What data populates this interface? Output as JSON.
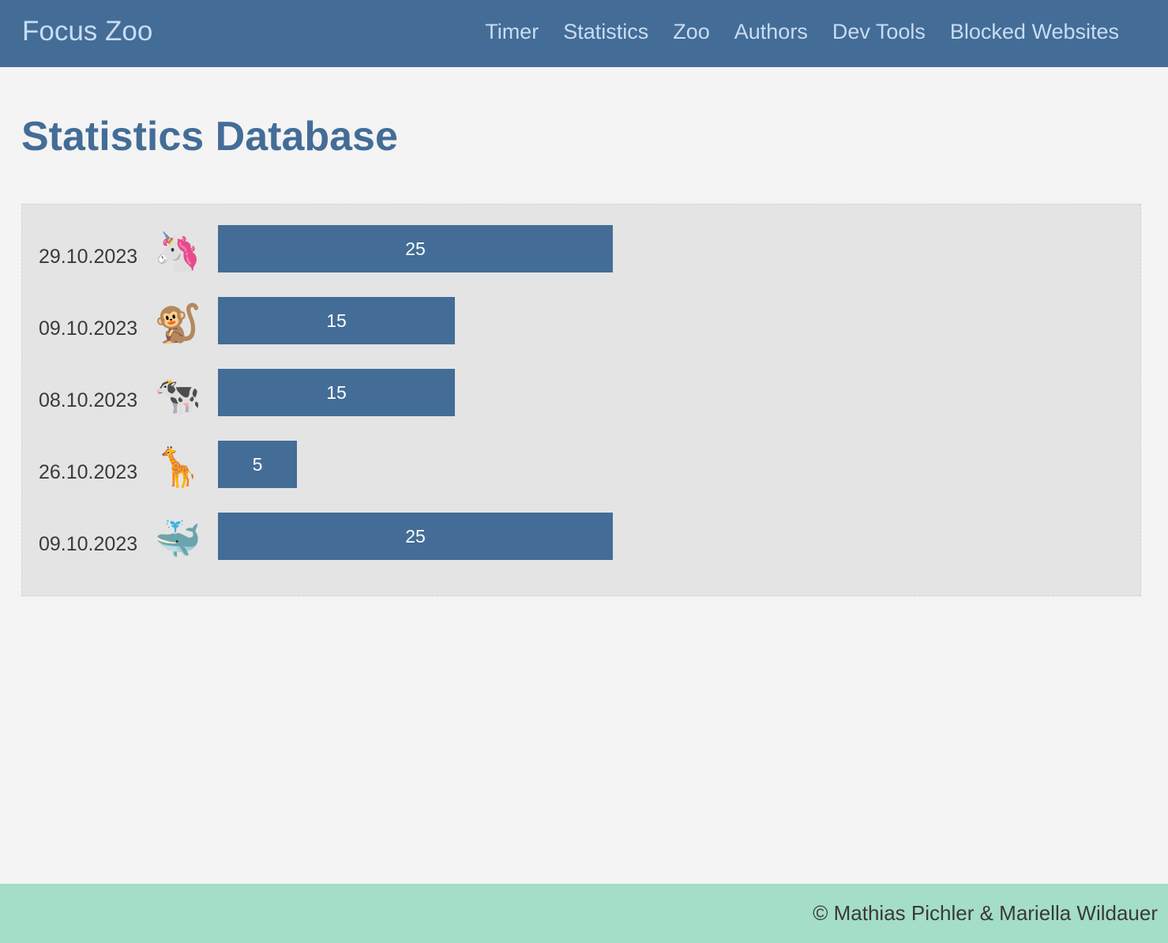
{
  "header": {
    "brand": "Focus Zoo",
    "nav": [
      {
        "label": "Timer"
      },
      {
        "label": "Statistics"
      },
      {
        "label": "Zoo"
      },
      {
        "label": "Authors"
      },
      {
        "label": "Dev Tools"
      },
      {
        "label": "Blocked Websites"
      }
    ]
  },
  "main": {
    "title": "Statistics Database",
    "rows": [
      {
        "date": "29.10.2023",
        "icon": "unicorn-icon",
        "emoji": "🦄",
        "value": "25"
      },
      {
        "date": "09.10.2023",
        "icon": "monkey-icon",
        "emoji": "🐒",
        "value": "15"
      },
      {
        "date": "08.10.2023",
        "icon": "cow-icon",
        "emoji": "🐄",
        "value": "15"
      },
      {
        "date": "26.10.2023",
        "icon": "giraffe-icon",
        "emoji": "🦒",
        "value": "5"
      },
      {
        "date": "09.10.2023",
        "icon": "whale-icon",
        "emoji": "🐳",
        "value": "25"
      }
    ]
  },
  "footer": {
    "text": "© Mathias Pichler & Mariella Wildauer"
  },
  "colors": {
    "primary": "#436d97",
    "nav_text": "#c9dcf2",
    "background": "#f4f4f4",
    "panel": "#e4e4e4",
    "footer": "#a4dec8"
  }
}
